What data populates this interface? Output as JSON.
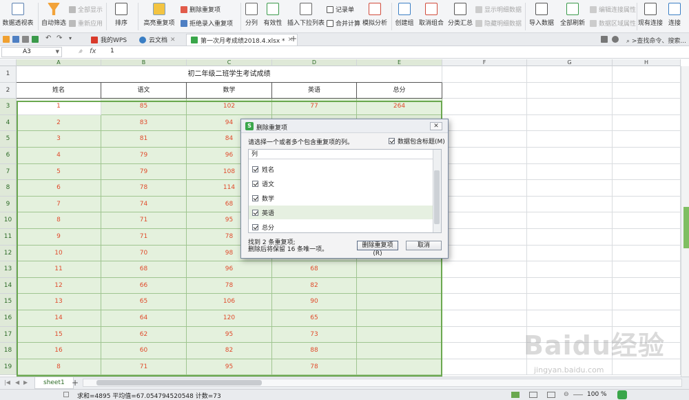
{
  "ribbon": {
    "pivot": "数据透视表",
    "autofilter": "自动筛选",
    "show_all": "全部显示",
    "reapply": "重新应用",
    "sort": "排序",
    "highlight_dup": "高亮重复项",
    "delete_dup": "删除重复项",
    "reject_dup": "拒绝录入重复项",
    "split": "分列",
    "validity": "有效性",
    "insert_dropdown": "插入下拉列表",
    "record_sheet": "记录单",
    "consolidate": "合并计算",
    "simulate": "模拟分析",
    "create_group": "创建组",
    "ungroup": "取消组合",
    "subtotal": "分类汇总",
    "show_detail": "显示明细数据",
    "hide_detail": "隐藏明细数据",
    "import_data": "导入数据",
    "refresh_all": "全部刷新",
    "edit_links": "编辑连接属性",
    "region_props": "数据区域属性",
    "existing_conn": "现有连接",
    "connect": "连接"
  },
  "tabs": {
    "wps": "我的WPS",
    "cloud": "云文档",
    "doc": "第一次月考成绩2018.4.xlsx *",
    "search": ">查找命令、搜索..."
  },
  "formula": {
    "namebox": "A3",
    "fx": "fx",
    "value": "1"
  },
  "columns": [
    "A",
    "B",
    "C",
    "D",
    "E",
    "F",
    "G",
    "H"
  ],
  "rows": [
    "1",
    "2",
    "3",
    "4",
    "5",
    "6",
    "7",
    "8",
    "9",
    "10",
    "11",
    "12",
    "13",
    "14",
    "15",
    "16",
    "17",
    "18",
    "19"
  ],
  "sheet": {
    "title": "初二年级二班学生考试成绩",
    "headers": [
      "姓名",
      "语文",
      "数学",
      "英语",
      "总分"
    ],
    "data": [
      [
        "1",
        "85",
        "102",
        "77",
        "264"
      ],
      [
        "2",
        "83",
        "94",
        "",
        ""
      ],
      [
        "3",
        "81",
        "84",
        "",
        ""
      ],
      [
        "4",
        "79",
        "96",
        "",
        ""
      ],
      [
        "5",
        "79",
        "108",
        "",
        ""
      ],
      [
        "6",
        "78",
        "114",
        "",
        ""
      ],
      [
        "7",
        "74",
        "68",
        "",
        ""
      ],
      [
        "8",
        "71",
        "95",
        "",
        ""
      ],
      [
        "9",
        "71",
        "78",
        "",
        ""
      ],
      [
        "10",
        "70",
        "98",
        "",
        ""
      ],
      [
        "11",
        "68",
        "96",
        "68",
        ""
      ],
      [
        "12",
        "66",
        "78",
        "82",
        ""
      ],
      [
        "13",
        "65",
        "106",
        "90",
        ""
      ],
      [
        "14",
        "64",
        "120",
        "65",
        ""
      ],
      [
        "15",
        "62",
        "95",
        "73",
        ""
      ],
      [
        "16",
        "60",
        "82",
        "88",
        ""
      ],
      [
        "8",
        "71",
        "95",
        "78",
        ""
      ]
    ]
  },
  "sheet_tab": "sheet1",
  "status": {
    "summary": "求和=4895  平均值=67.054794520548  计数=73",
    "zoom": "100 %"
  },
  "dialog": {
    "title": "删除重复项",
    "close": "✕",
    "prompt": "请选择一个或者多个包含重复项的列。",
    "header_checkbox": "数据包含标题(M)",
    "list_header": "列",
    "items": [
      "姓名",
      "语文",
      "数学",
      "英语",
      "总分"
    ],
    "message_line1": "找到 2 条重复项;",
    "message_line2": "删除后将保留 16 条唯一项。",
    "btn_delete": "删除重复项(R)",
    "btn_cancel": "取消"
  },
  "watermark": {
    "main": "Baidu经验",
    "sub": "jingyan.baidu.com"
  },
  "colors": {
    "accent_green": "#6aa84f",
    "data_red": "#e04a2b",
    "selection_fill": "#e4f1dd"
  }
}
